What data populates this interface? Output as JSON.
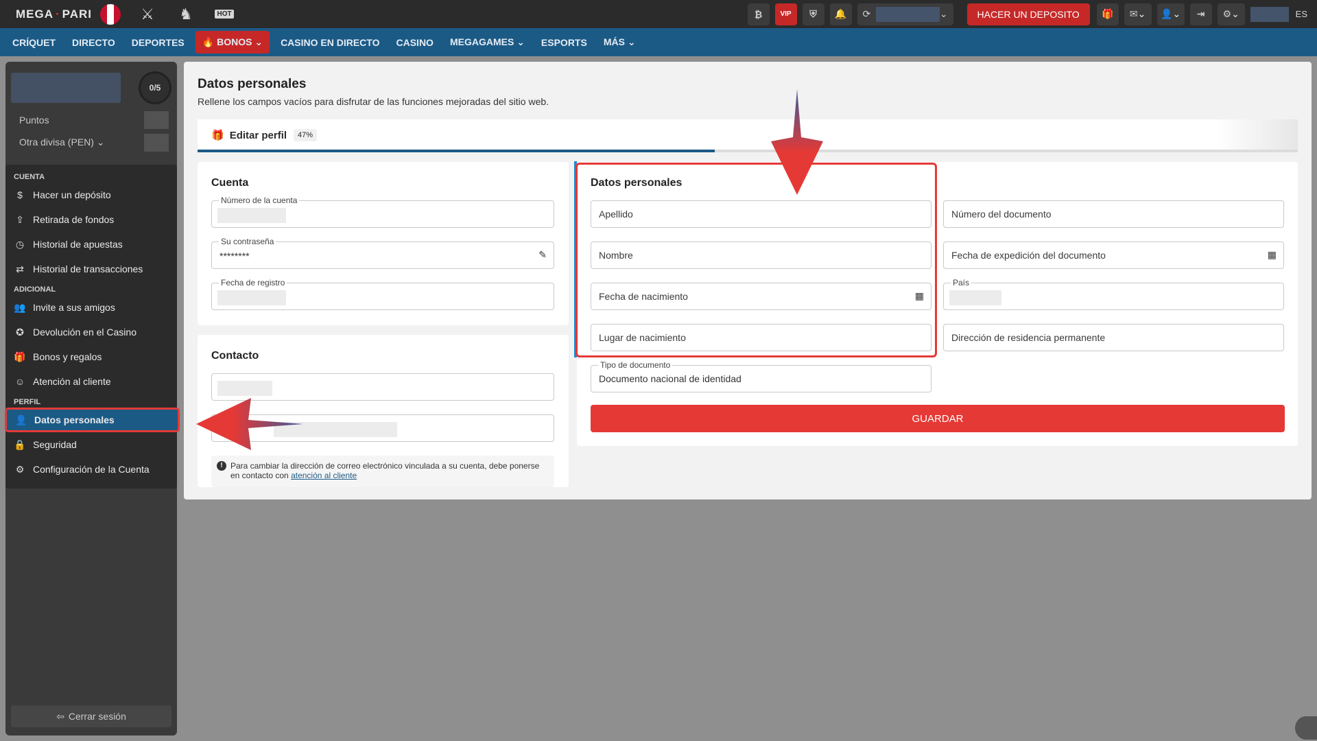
{
  "brand": {
    "logo_left": "MEGA",
    "logo_right": "PARI"
  },
  "top_icons": [
    "dota-icon",
    "esports-figure-icon",
    "hot-games-icon"
  ],
  "hot_label": "HOT",
  "top": {
    "deposit_label": "HACER UN DEPOSITO",
    "lang": "ES",
    "vip": "VIP",
    "btc": "₿"
  },
  "nav": [
    "CRÍQUET",
    "DIRECTO",
    "DEPORTES",
    "BONOS",
    "CASINO EN DIRECTO",
    "CASINO",
    "MEGAGAMES",
    "ESPORTS",
    "MÁS"
  ],
  "sidebar": {
    "progress": "0/5",
    "points_label": "Puntos",
    "currency_label": "Otra divisa (PEN)",
    "sections": {
      "cuenta": "CUENTA",
      "adicional": "ADICIONAL",
      "perfil": "PERFIL"
    },
    "items": [
      "Hacer un depósito",
      "Retirada de fondos",
      "Historial de apuestas",
      "Historial de transacciones",
      "Invite a sus amigos",
      "Devolución en el Casino",
      "Bonos y regalos",
      "Atención al cliente",
      "Datos personales",
      "Seguridad",
      "Configuración de la Cuenta"
    ],
    "logout": "Cerrar sesión"
  },
  "main": {
    "title": "Datos personales",
    "subtitle": "Rellene los campos vacíos para disfrutar de las funciones mejoradas del sitio web.",
    "edit_profile": "Editar perfil",
    "percent": "47%",
    "progress_fraction": 0.47
  },
  "cuenta": {
    "title": "Cuenta",
    "account_number_label": "Número de la cuenta",
    "password_label": "Su contraseña",
    "password_value": "********",
    "registration_label": "Fecha de registro"
  },
  "contacto": {
    "title": "Contacto",
    "note": "Para cambiar la dirección de correo electrónico vinculada a su cuenta, debe ponerse en contacto con",
    "note_link": "atención al cliente"
  },
  "personal": {
    "title": "Datos personales",
    "apellido": "Apellido",
    "nombre": "Nombre",
    "fecha_nacimiento": "Fecha de nacimiento",
    "lugar_nacimiento": "Lugar de nacimiento",
    "tipo_doc_label": "Tipo de documento",
    "tipo_doc_value": "Documento nacional de identidad",
    "numero_doc": "Número del documento",
    "fecha_exp": "Fecha de expedición del documento",
    "pais_label": "País",
    "direccion": "Dirección de residencia permanente",
    "save": "GUARDAR"
  },
  "colors": {
    "accent": "#e53935",
    "nav": "#1c5a86",
    "dark": "#2b2b2b"
  }
}
